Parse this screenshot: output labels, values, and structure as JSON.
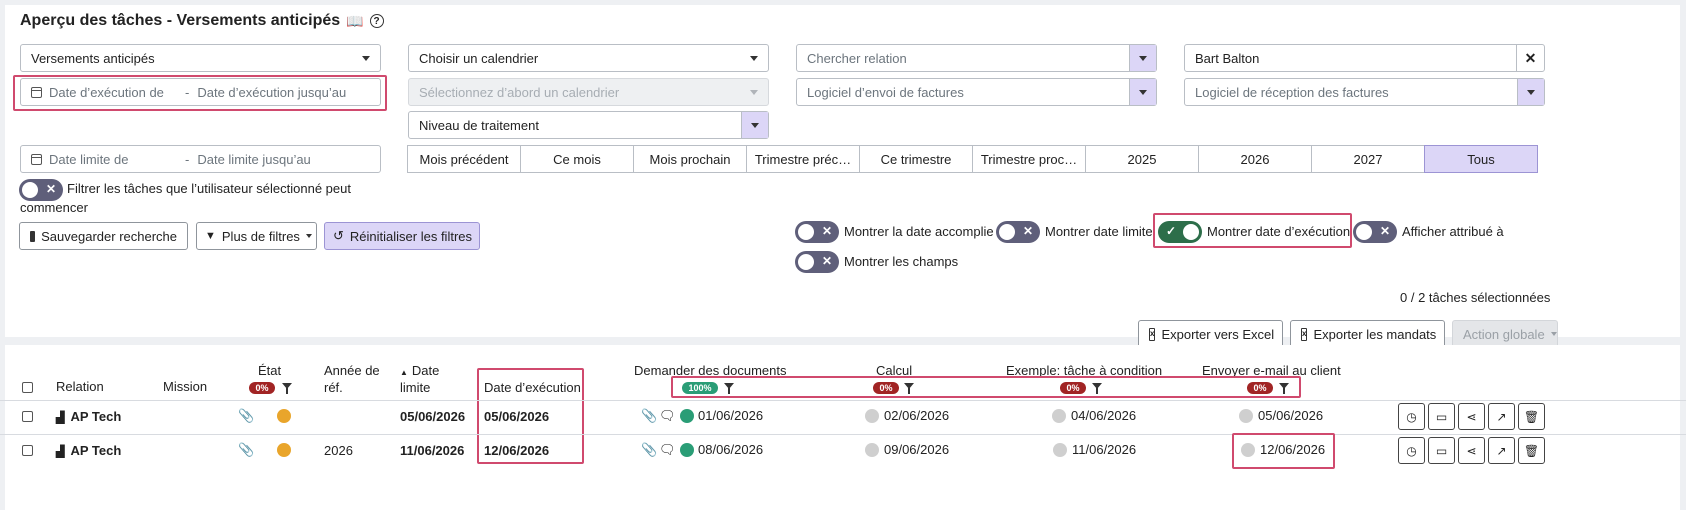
{
  "page": {
    "title": "Aperçu des tâches - Versements anticipés",
    "title_icons": [
      "book-icon",
      "help-icon"
    ]
  },
  "filters": {
    "task_type": "Versements anticipés",
    "calendar": "Choisir un calendrier",
    "relation_placeholder": "Chercher relation",
    "user": "Bart Balton",
    "exec_from": "Date d’exécution de",
    "exec_to": "Date d’exécution jusqu’au",
    "calendar_first": "Sélectionnez d’abord un calendrier",
    "send_software": "Logiciel d’envoi de factures",
    "receive_software": "Logiciel de réception des factures",
    "processing_level": "Niveau de traitement",
    "deadline_from": "Date limite de",
    "deadline_to": "Date limite jusqu’au",
    "separator": "-",
    "periods": [
      "Mois précédent",
      "Ce mois",
      "Mois prochain",
      "Trimestre préc…",
      "Ce trimestre",
      "Trimestre proc…",
      "2025",
      "2026",
      "2027",
      "Tous"
    ],
    "active_period": "Tous",
    "user_toggle_label": "Filtrer les tâches que l’utilisateur sélectionné peut",
    "user_toggle_label2": "commencer"
  },
  "actions": {
    "save_search": "Sauvegarder recherche",
    "more_filters": "Plus de filtres",
    "reset_filters": "Réinitialiser les filtres",
    "export_excel": "Exporter vers Excel",
    "export_mandates": "Exporter les mandats",
    "global_action": "Action globale"
  },
  "toggles": {
    "completed_date": "Montrer la date accomplie",
    "deadline": "Montrer date limite",
    "exec_date": "Montrer date d’exécution",
    "assigned_to": "Afficher attribué à",
    "fields": "Montrer les champs"
  },
  "selection_count": "0 / 2 tâches sélectionnées",
  "table": {
    "headers": {
      "relation": "Relation",
      "mission": "Mission",
      "etat": "État",
      "annee1": "Année de",
      "annee2": "réf.",
      "limite1": "Date",
      "limite2": "limite",
      "exec": "Date d’exécution",
      "docs": "Demander des documents",
      "calcul": "Calcul",
      "condition": "Exemple: tâche à condition",
      "email": "Envoyer e-mail au client"
    },
    "badges": {
      "etat": "0%",
      "docs": "100%",
      "calcul": "0%",
      "condition": "0%",
      "email": "0%"
    },
    "rows": [
      {
        "relation": "AP Tech",
        "annee": "",
        "limite": "05/06/2026",
        "exec": "05/06/2026",
        "docs": "01/06/2026",
        "calcul": "02/06/2026",
        "condition": "04/06/2026",
        "email": "05/06/2026"
      },
      {
        "relation": "AP Tech",
        "annee": "2026",
        "limite": "11/06/2026",
        "exec": "12/06/2026",
        "docs": "08/06/2026",
        "calcul": "09/06/2026",
        "condition": "11/06/2026",
        "email": "12/06/2026"
      }
    ]
  },
  "colors": {
    "accent_purple": "#dcd6f7",
    "highlight": "#d04a6e",
    "status_orange": "#e9a52b",
    "status_green": "#2a9d76",
    "badge_red": "#a12424"
  }
}
